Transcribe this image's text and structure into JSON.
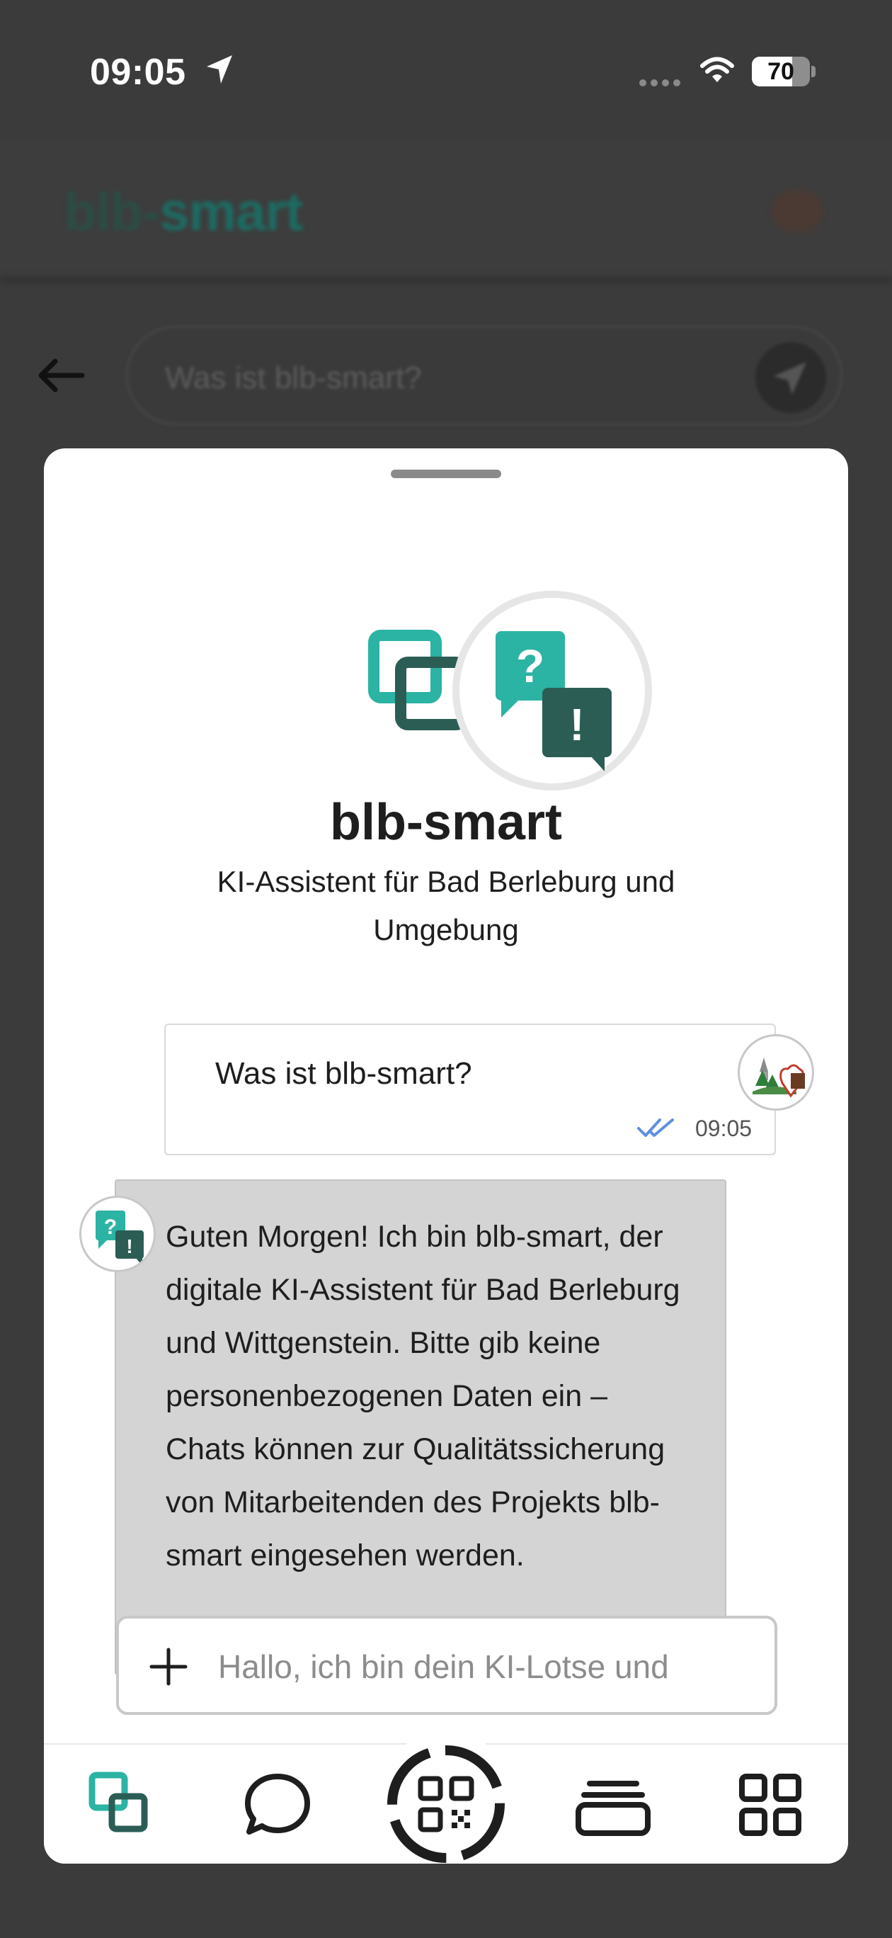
{
  "status_bar": {
    "time": "09:05",
    "battery": "70",
    "battery_level": 0.7,
    "location_icon": "location-arrow-icon",
    "signal_icon": "signal-dots-icon",
    "wifi_icon": "wifi-icon"
  },
  "background": {
    "logo_part1": "blb-",
    "logo_part2": "smart",
    "search_value": "Was ist blb-smart?",
    "back_icon": "arrow-left-icon",
    "send_icon": "send-icon"
  },
  "sheet": {
    "app_name": "blb-smart",
    "subtitle": "KI-Assistent für Bad Berleburg und Umgebung"
  },
  "messages": [
    {
      "role": "user",
      "text": "Was ist blb-smart?",
      "time": "09:05",
      "status_icon": "double-check-icon"
    },
    {
      "role": "assistant",
      "text": "Guten Morgen! Ich bin blb-smart, der digitale KI-Assistent für Bad Berleburg und Wittgenstein. Bitte gib keine personenbezogenen Daten ein – Chats können zur Qualitätssicherung von Mitarbeitenden des Projekts blb-smart eingesehen werden."
    }
  ],
  "composer": {
    "placeholder": "Hallo, ich bin dein KI-Lotse und helfe dir gern",
    "value": ""
  },
  "nav": {
    "items": [
      "home-squares-icon",
      "chat-bubble-icon",
      "qr-scan-icon",
      "cards-stack-icon",
      "grid-apps-icon"
    ]
  },
  "colors": {
    "teal": "#2bb3a3",
    "dark_teal": "#2b5d55",
    "check_blue": "#5b8fe0",
    "bubble_gray": "#d4d4d4"
  }
}
